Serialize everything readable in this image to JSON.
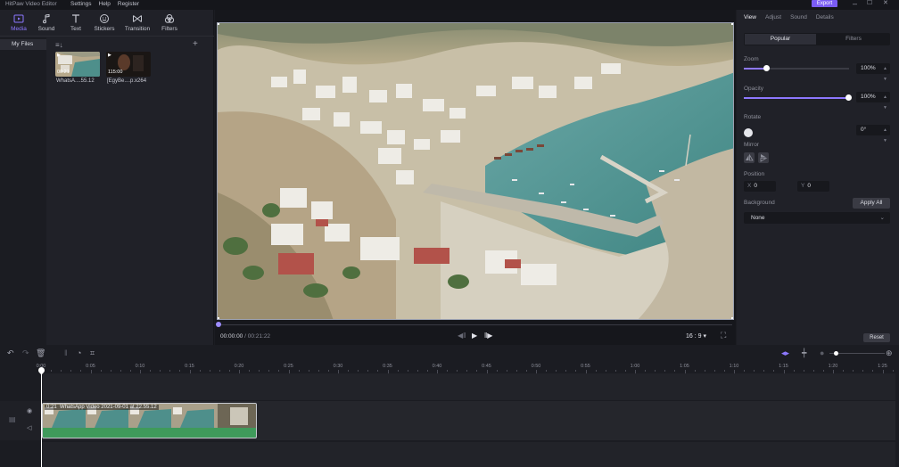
{
  "titlebar": {
    "app_title": "HitPaw Video Editor",
    "menu": [
      "Settings",
      "Help",
      "Register"
    ],
    "export_label": "Export",
    "minimize": "–",
    "maximize": "☐",
    "close": "✕"
  },
  "media_toolbar": [
    {
      "label": "Media",
      "icon": "media-icon",
      "active": true
    },
    {
      "label": "Sound",
      "icon": "music-note-icon",
      "active": false
    },
    {
      "label": "Text",
      "icon": "text-icon",
      "active": false
    },
    {
      "label": "Stickers",
      "icon": "smiley-icon",
      "active": false
    },
    {
      "label": "Transition",
      "icon": "transition-icon",
      "active": false
    },
    {
      "label": "Filters",
      "icon": "filters-icon",
      "active": false
    }
  ],
  "media_panel": {
    "sidebar_item": "My Files",
    "add_icon": "+",
    "files": [
      {
        "name": "WhatsA....55.12",
        "duration": "00:21"
      },
      {
        "name": "[EgyBe....p.x264",
        "duration": "115:00"
      }
    ]
  },
  "preview": {
    "current_time": "00:00:00",
    "separator": "/",
    "total_time": "00:21:22",
    "aspect_ratio": "16 : 9",
    "aspect_chevron": "▾"
  },
  "properties": {
    "tabs": [
      "View",
      "Adjust",
      "Sound",
      "Details"
    ],
    "active_tab": "View",
    "segments": [
      "Popular",
      "Filters"
    ],
    "zoom": {
      "label": "Zoom",
      "value": "100%",
      "level": 0.22
    },
    "opacity": {
      "label": "Opacity",
      "value": "100%",
      "level": 1.0
    },
    "rotate": {
      "label": "Rotate",
      "value": "0°"
    },
    "mirror": {
      "label": "Mirror"
    },
    "position": {
      "label": "Position",
      "x_axis": "X",
      "x_value": "0",
      "y_axis": "Y",
      "y_value": "0"
    },
    "background": {
      "label": "Background",
      "apply_all": "Apply All",
      "selected": "None"
    },
    "reset_label": "Reset"
  },
  "timeline": {
    "ruler": [
      "0:00",
      "0:05",
      "0:10",
      "0:15",
      "0:20",
      "0:25",
      "0:30",
      "0:35",
      "0:40",
      "0:45",
      "0:50",
      "0:55",
      "1:00",
      "1:05",
      "1:10",
      "1:15",
      "1:20",
      "1:25"
    ],
    "clip_duration": "0:21",
    "clip_title": "WhatsApp Video 2021-09-01 at 22.55.12"
  },
  "colors": {
    "accent": "#8d78ff",
    "export": "#7a5cf5",
    "audio_track": "#3f9a5b"
  }
}
